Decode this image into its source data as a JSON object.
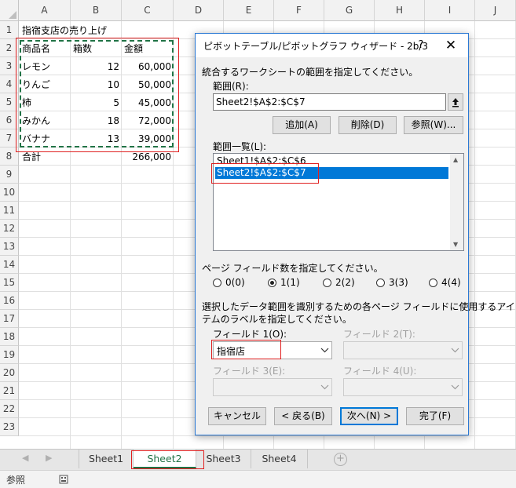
{
  "sheet": {
    "columns": [
      "A",
      "B",
      "C",
      "D",
      "E",
      "F",
      "G",
      "H",
      "I",
      "J"
    ],
    "rows": [
      "1",
      "2",
      "3",
      "4",
      "5",
      "6",
      "7",
      "8",
      "9",
      "10",
      "11",
      "12",
      "13",
      "14",
      "15",
      "16",
      "17",
      "18",
      "19",
      "20",
      "21",
      "22",
      "23"
    ],
    "title_cell": "指宿支店の売り上げ",
    "headers": [
      "商品名",
      "箱数",
      "金額"
    ],
    "data_rows": [
      {
        "name": "レモン",
        "qty": "12",
        "amount": "60,000"
      },
      {
        "name": "りんご",
        "qty": "10",
        "amount": "50,000"
      },
      {
        "name": "柿",
        "qty": "5",
        "amount": "45,000"
      },
      {
        "name": "みかん",
        "qty": "18",
        "amount": "72,000"
      },
      {
        "name": "バナナ",
        "qty": "13",
        "amount": "39,000"
      }
    ],
    "total_label": "合計",
    "total_value": "266,000"
  },
  "tabs": [
    "Sheet1",
    "Sheet2",
    "Sheet3",
    "Sheet4"
  ],
  "active_tab": "Sheet2",
  "status": {
    "mode": "参照"
  },
  "dialog": {
    "title": "ピボットテーブル/ピボットグラフ ウィザード - 2b/3",
    "help": "?",
    "close": "✕",
    "instruction1": "統合するワークシートの範囲を指定してください。",
    "range_label": "範囲(R):",
    "range_value": "Sheet2!$A$2:$C$7",
    "btn_add": "追加(A)",
    "btn_delete": "削除(D)",
    "btn_browse": "参照(W)...",
    "list_label": "範囲一覧(L):",
    "list_items": [
      "Sheet1!$A$2:$C$6",
      "Sheet2!$A$2:$C$7"
    ],
    "page_fields_label": "ページ フィールド数を指定してください。",
    "radios": [
      "0(0)",
      "1(1)",
      "2(2)",
      "3(3)",
      "4(4)"
    ],
    "selected_radio": "1(1)",
    "label_instruction_line1": "選択したデータ範囲を識別するための各ページ フィールドに使用するアイ",
    "label_instruction_line2": "テムのラベルを指定してください。",
    "field1_label": "フィールド 1(O):",
    "field1_value": "指宿店",
    "field2_label": "フィールド 2(T):",
    "field3_label": "フィールド 3(E):",
    "field4_label": "フィールド 4(U):",
    "btn_cancel": "キャンセル",
    "btn_back": "< 戻る(B)",
    "btn_next": "次へ(N) >",
    "btn_finish": "完了(F)"
  }
}
